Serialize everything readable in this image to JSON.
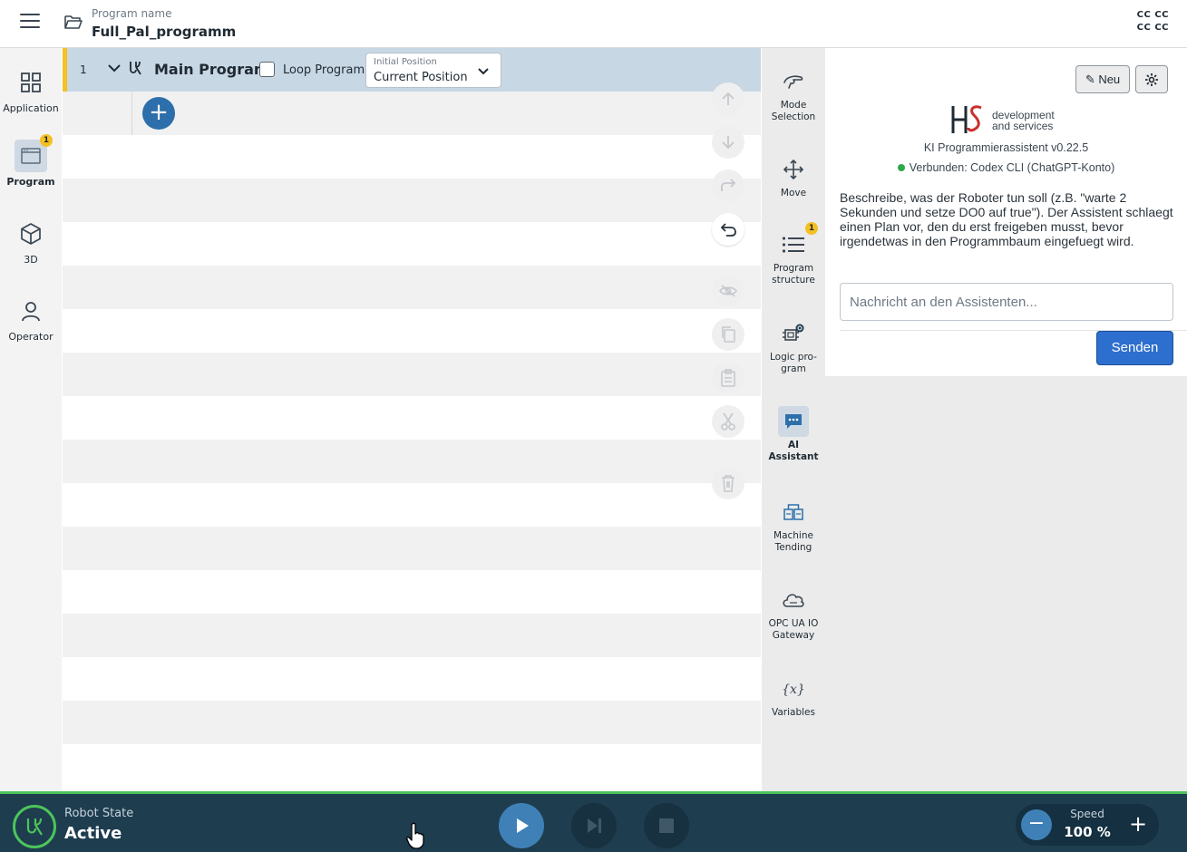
{
  "header": {
    "program_label": "Program name",
    "program_name": "Full_Pal_programm",
    "corner_line1": "CC CC",
    "corner_line2": "CC CC"
  },
  "leftnav": {
    "items": [
      {
        "label": "Application",
        "icon": "grid-icon"
      },
      {
        "label": "Program",
        "icon": "program-window-icon",
        "badge": "1",
        "active": true
      },
      {
        "label": "3D",
        "icon": "cube-icon"
      },
      {
        "label": "Operator",
        "icon": "user-icon"
      }
    ]
  },
  "tree": {
    "row_number": "1",
    "main_title": "Main Program",
    "loop_label": "Loop Program",
    "loop_checked": false,
    "initial_position_label": "Initial Position",
    "initial_position_value": "Current Position"
  },
  "tabs": {
    "items": [
      {
        "label": "Mode Selection",
        "icon": "hand-icon"
      },
      {
        "label": "Move",
        "icon": "move-arrows-icon"
      },
      {
        "label": "Program structure",
        "icon": "list-icon",
        "badge": "1"
      },
      {
        "label": "Logic pro-gram",
        "icon": "logic-icon"
      },
      {
        "label": "AI Assistant",
        "icon": "chat-icon",
        "active": true
      },
      {
        "label": "Machine Tending",
        "icon": "machine-icon"
      },
      {
        "label": "OPC UA IO Gateway",
        "icon": "cloud-icon"
      },
      {
        "label": "Variables",
        "icon": "variables-icon"
      }
    ]
  },
  "assistant": {
    "new_button": "✎ Neu",
    "settings_icon": "gear-icon",
    "logo_line1": "development",
    "logo_line2": "and services",
    "version": "KI Programmierassistent v0.22.5",
    "status": "Verbunden: Codex CLI (ChatGPT-Konto)",
    "description": "Beschreibe, was der Roboter tun soll (z.B. \"warte 2 Sekunden und setze DO0 auf true\"). Der Assistent schlaegt einen Plan vor, den du erst freigeben musst, bevor irgendetwas in den Programmbaum eingefuegt wird.",
    "input_placeholder": "Nachricht an den Assistenten...",
    "send_button": "Senden"
  },
  "footer": {
    "robot_state_label": "Robot State",
    "robot_state_value": "Active",
    "speed_label": "Speed",
    "speed_value": "100 %"
  },
  "colors": {
    "accent": "#2d6fab",
    "footer_bg": "#1e3d4f",
    "status_green": "#4cc55a",
    "badge": "#f5c021"
  }
}
